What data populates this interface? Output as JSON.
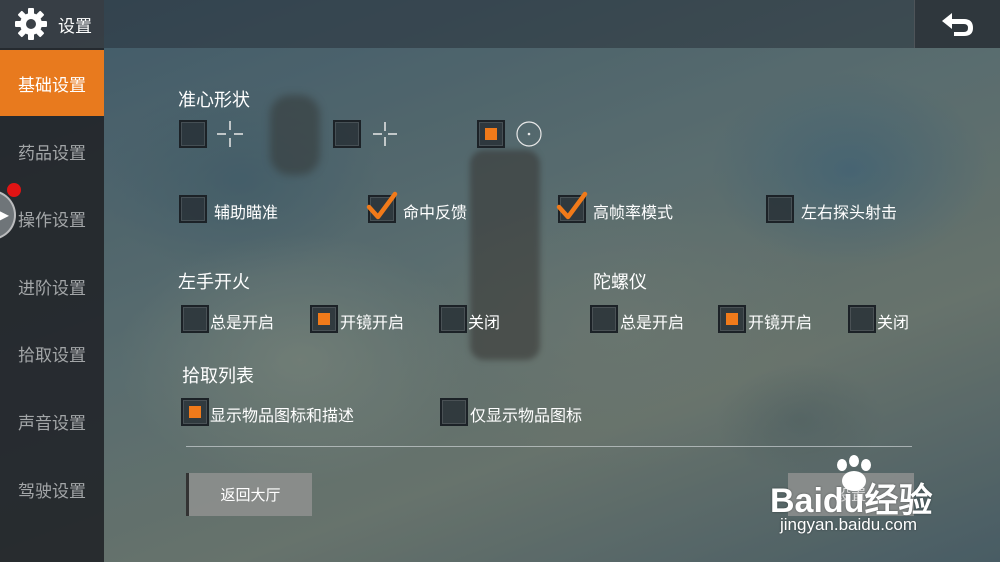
{
  "header": {
    "title": "设置",
    "settings_icon": "gear-icon",
    "back_icon": "return-arrow-icon"
  },
  "sidebar": {
    "items": [
      {
        "label": "基础设置",
        "active": true
      },
      {
        "label": "药品设置",
        "active": false
      },
      {
        "label": "操作设置",
        "active": false
      },
      {
        "label": "进阶设置",
        "active": false
      },
      {
        "label": "拾取设置",
        "active": false
      },
      {
        "label": "声音设置",
        "active": false
      },
      {
        "label": "驾驶设置",
        "active": false
      }
    ],
    "notification_color": "#e01414",
    "accent_color": "#e87a1e"
  },
  "crosshair": {
    "title": "准心形状",
    "options": [
      {
        "icon": "cross-gap-icon",
        "checked": false
      },
      {
        "icon": "cross-small-icon",
        "checked": false
      },
      {
        "icon": "dot-circle-icon",
        "checked": true
      }
    ]
  },
  "toggles": [
    {
      "label": "辅助瞄准",
      "checked": false
    },
    {
      "label": "命中反馈",
      "checked": true
    },
    {
      "label": "高帧率模式",
      "checked": true
    },
    {
      "label": "左右探头射击",
      "checked": false
    }
  ],
  "left_fire": {
    "title": "左手开火",
    "options": [
      {
        "label": "总是开启",
        "checked": false
      },
      {
        "label": "开镜开启",
        "checked": true
      },
      {
        "label": "关闭",
        "checked": false
      }
    ]
  },
  "gyroscope": {
    "title": "陀螺仪",
    "options": [
      {
        "label": "总是开启",
        "checked": false
      },
      {
        "label": "开镜开启",
        "checked": true
      },
      {
        "label": "关闭",
        "checked": false
      }
    ]
  },
  "pickup_list": {
    "title": "拾取列表",
    "options": [
      {
        "label": "显示物品图标和描述",
        "checked": true
      },
      {
        "label": "仅显示物品图标",
        "checked": false
      }
    ]
  },
  "footer": {
    "return_lobby_label": "返回大厅",
    "right_button_label": "设置"
  },
  "watermark": {
    "brand": "Baidu经验",
    "url": "jingyan.baidu.com"
  }
}
